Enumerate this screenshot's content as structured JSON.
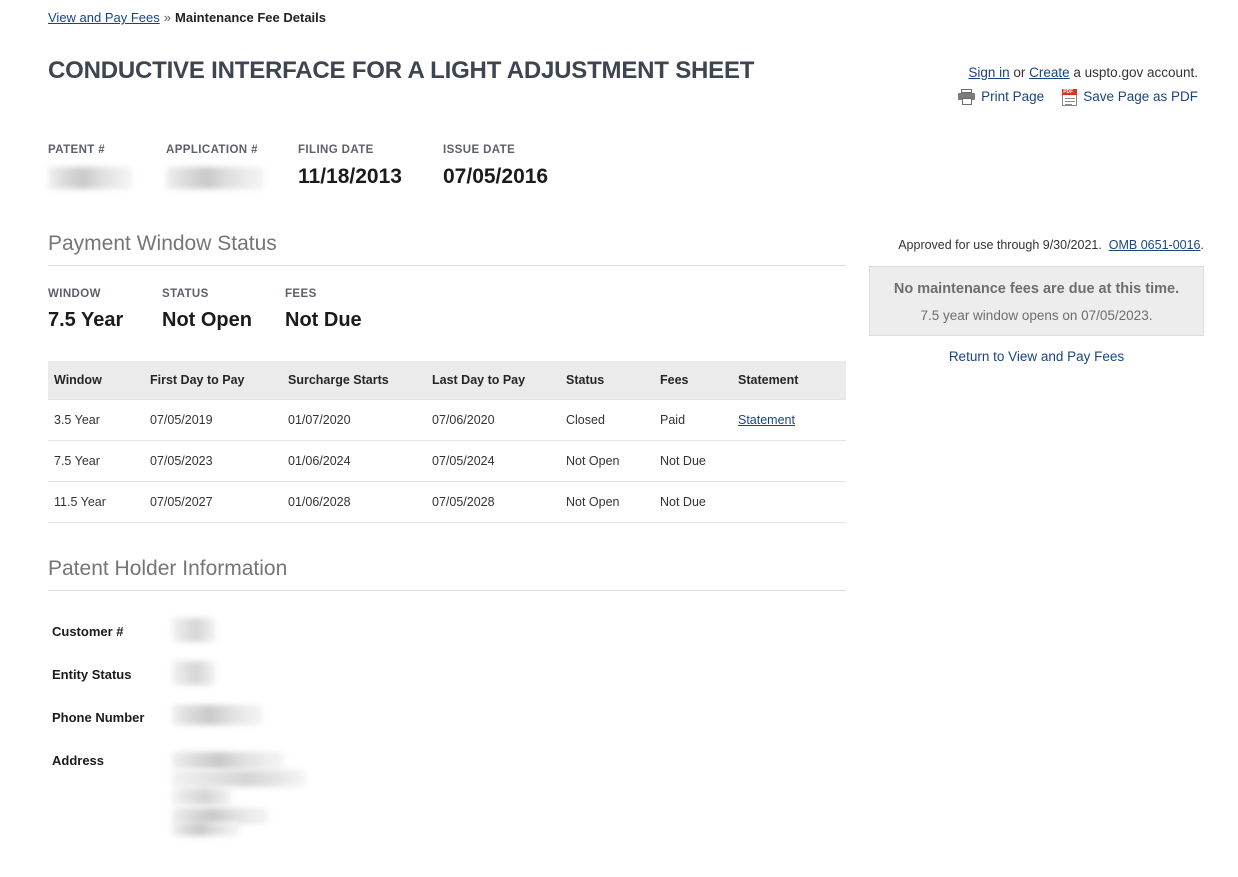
{
  "breadcrumb": {
    "link_label": "View and Pay Fees",
    "separator": "»",
    "current": "Maintenance Fee Details"
  },
  "page_title": "CONDUCTIVE INTERFACE FOR A LIGHT ADJUSTMENT SHEET",
  "account": {
    "sign_in": "Sign in",
    "or": " or ",
    "create": "Create",
    "suffix": " a uspto.gov account.",
    "print_label": "Print Page",
    "pdf_label": "Save Page as PDF",
    "print_icon": "printer-icon",
    "pdf_icon": "pdf-file-icon"
  },
  "patent_meta": [
    {
      "label": "PATENT #",
      "value": "",
      "redacted": true
    },
    {
      "label": "APPLICATION #",
      "value": "",
      "redacted": true
    },
    {
      "label": "FILING DATE",
      "value": "11/18/2013",
      "redacted": false
    },
    {
      "label": "ISSUE DATE",
      "value": "07/05/2016",
      "redacted": false
    }
  ],
  "payment_window": {
    "heading": "Payment Window Status",
    "items": [
      {
        "label": "WINDOW",
        "value": "7.5 Year"
      },
      {
        "label": "STATUS",
        "value": "Not Open"
      },
      {
        "label": "FEES",
        "value": "Not Due"
      }
    ]
  },
  "fee_table": {
    "columns": [
      "Window",
      "First Day to Pay",
      "Surcharge Starts",
      "Last Day to Pay",
      "Status",
      "Fees",
      "Statement"
    ],
    "rows": [
      {
        "window": "3.5 Year",
        "first_day": "07/05/2019",
        "surcharge": "01/07/2020",
        "last_day": "07/06/2020",
        "status": "Closed",
        "fees": "Paid",
        "statement": "Statement",
        "statement_is_link": true
      },
      {
        "window": "7.5 Year",
        "first_day": "07/05/2023",
        "surcharge": "01/06/2024",
        "last_day": "07/05/2024",
        "status": "Not Open",
        "fees": "Not Due",
        "statement": "",
        "statement_is_link": false
      },
      {
        "window": "11.5 Year",
        "first_day": "07/05/2027",
        "surcharge": "01/06/2028",
        "last_day": "07/05/2028",
        "status": "Not Open",
        "fees": "Not Due",
        "statement": "",
        "statement_is_link": false
      }
    ]
  },
  "sidebar": {
    "omb_prefix": "Approved for use through 9/30/2021.",
    "omb_link": "OMB 0651-0016",
    "omb_suffix": ".",
    "notice_line1": "No maintenance fees are due at this time.",
    "notice_line2": "7.5 year window opens on 07/05/2023.",
    "return_link": "Return to View and Pay Fees"
  },
  "patent_holder": {
    "heading": "Patent Holder Information",
    "fields": [
      {
        "label": "Customer #",
        "value": "",
        "redacted": true
      },
      {
        "label": "Entity Status",
        "value": "",
        "redacted": true
      },
      {
        "label": "Phone Number",
        "value": "",
        "redacted": true
      },
      {
        "label": "Address",
        "value": "",
        "redacted": true
      }
    ]
  },
  "colors": {
    "link": "#1a4480",
    "heading_gray": "#757575",
    "table_header_bg": "#ebebeb",
    "notice_bg": "#ededed",
    "pdf_red": "#d4361f"
  }
}
